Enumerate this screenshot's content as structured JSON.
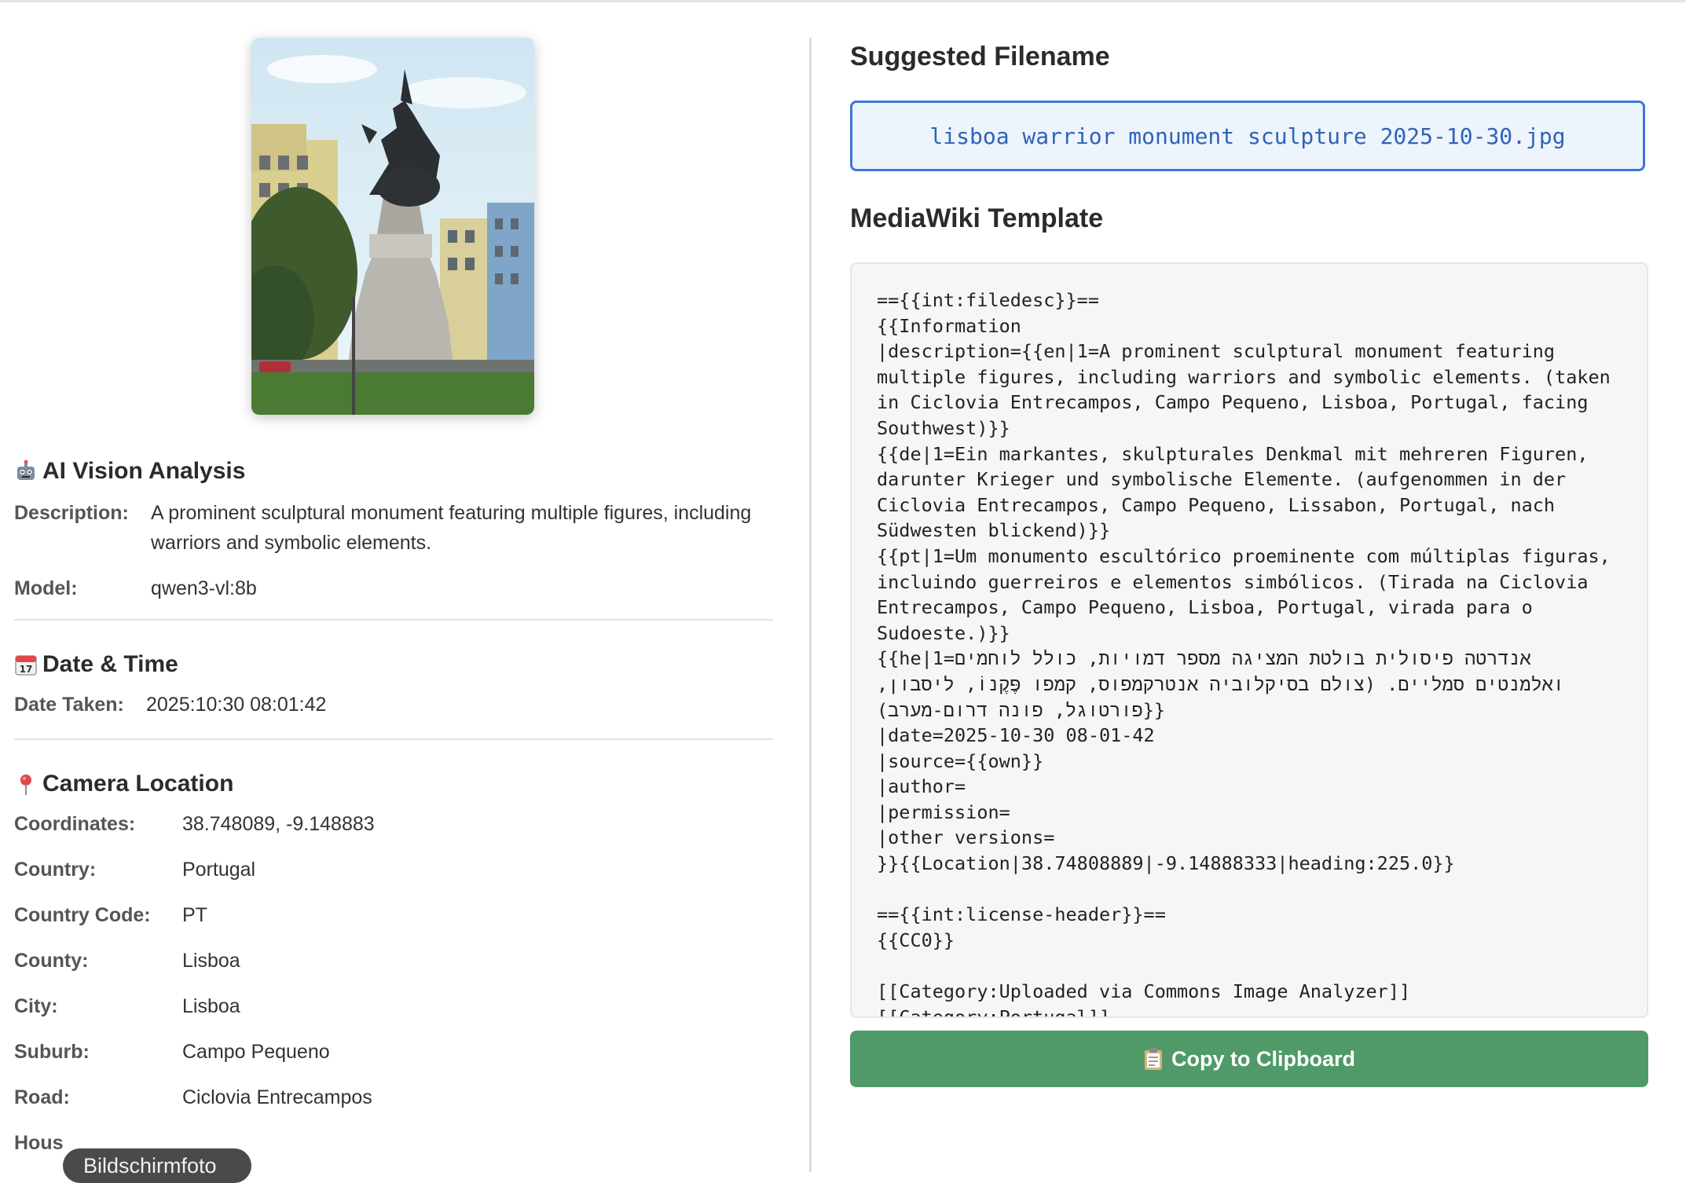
{
  "photo": {
    "alt": "Monument photo"
  },
  "ai": {
    "icon": "robot-icon",
    "title": "AI Vision Analysis",
    "description_label": "Description:",
    "description": "A prominent sculptural monument featuring multiple figures, including warriors and symbolic elements.",
    "model_label": "Model:",
    "model": "qwen3-vl:8b"
  },
  "datetime": {
    "icon": "calendar-icon",
    "title": "Date & Time",
    "date_label": "Date Taken:",
    "date": "2025:10:30 08:01:42"
  },
  "location": {
    "icon": "pin-icon",
    "title": "Camera Location",
    "rows": [
      {
        "label": "Coordinates:",
        "value": "38.748089, -9.148883"
      },
      {
        "label": "Country:",
        "value": "Portugal"
      },
      {
        "label": "Country Code:",
        "value": "PT"
      },
      {
        "label": "County:",
        "value": "Lisboa"
      },
      {
        "label": "City:",
        "value": "Lisboa"
      },
      {
        "label": "Suburb:",
        "value": "Campo Pequeno"
      },
      {
        "label": "Road:",
        "value": "Ciclovia Entrecampos"
      },
      {
        "label": "Hous",
        "value": ""
      }
    ]
  },
  "filename": {
    "title": "Suggested Filename",
    "value": "lisboa warrior monument sculpture 2025-10-30.jpg"
  },
  "template": {
    "title": "MediaWiki Template",
    "text": "=={{int:filedesc}}==\n{{Information\n|description={{en|1=A prominent sculptural monument featuring multiple figures, including warriors and symbolic elements. (taken in Ciclovia Entrecampos, Campo Pequeno, Lisboa, Portugal, facing Southwest)}}\n{{de|1=Ein markantes, skulpturales Denkmal mit mehreren Figuren, darunter Krieger und symbolische Elemente. (aufgenommen in der Ciclovia Entrecampos, Campo Pequeno, Lissabon, Portugal, nach Südwesten blickend)}}\n{{pt|1=Um monumento escultórico proeminente com múltiplas figuras, incluindo guerreiros e elementos simbólicos. (Tirada na Ciclovia Entrecampos, Campo Pequeno, Lisboa, Portugal, virada para o Sudoeste.)}}\n{{he|1=אנדרטה פיסולית בולטת המציגה מספר דמויות, כולל לוחמים ואלמנטים סמליים. (צולם בסיקלוביה אנטרקמפוס, קמפו פֶּקֶנוֹ, ליסבון, פורטוגל, פונה דרום-מערב)}}\n|date=2025-10-30 08-01-42\n|source={{own}}\n|author=\n|permission=\n|other versions=\n}}{{Location|38.74808889|-9.14888333|heading:225.0}}\n\n=={{int:license-header}}==\n{{CC0}}\n\n[[Category:Uploaded via Commons Image Analyzer]]\n[[Category:Portugal]]\n[[Category:Lisboa]]"
  },
  "copy_button": {
    "icon": "clipboard-icon",
    "label": "Copy to Clipboard"
  },
  "tooltip": {
    "text": "Bildschirmfoto"
  }
}
